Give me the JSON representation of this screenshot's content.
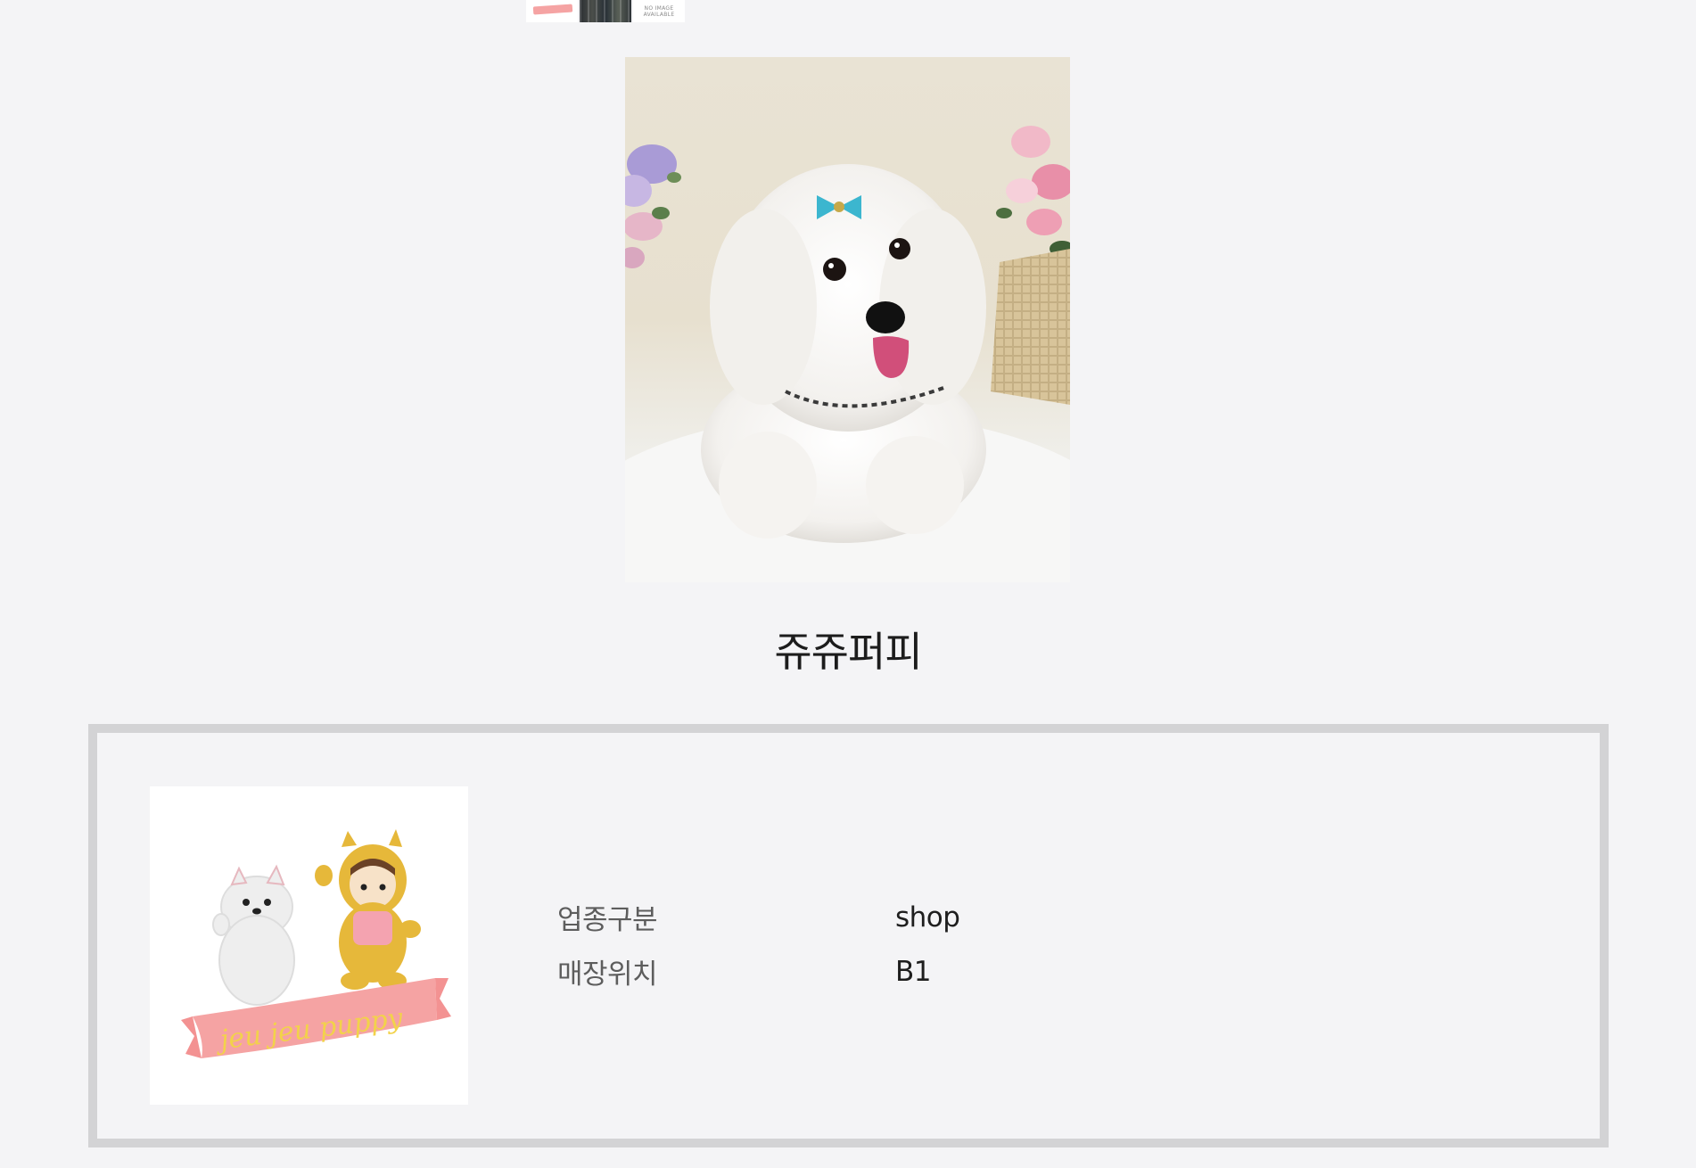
{
  "thumbnails": {
    "no_image_line1": "NO IMAGE",
    "no_image_line2": "AVAILABLE"
  },
  "shop": {
    "name": "쥬쥬퍼피"
  },
  "logo": {
    "text": "jeu jeu puppy"
  },
  "details": [
    {
      "label": "업종구분",
      "value": "shop"
    },
    {
      "label": "매장위치",
      "value": "B1"
    }
  ],
  "colors": {
    "background": "#f4f4f6",
    "panel_border": "#d3d3d5",
    "ribbon": "#f5a3a3",
    "logo_text": "#f2d24a"
  }
}
